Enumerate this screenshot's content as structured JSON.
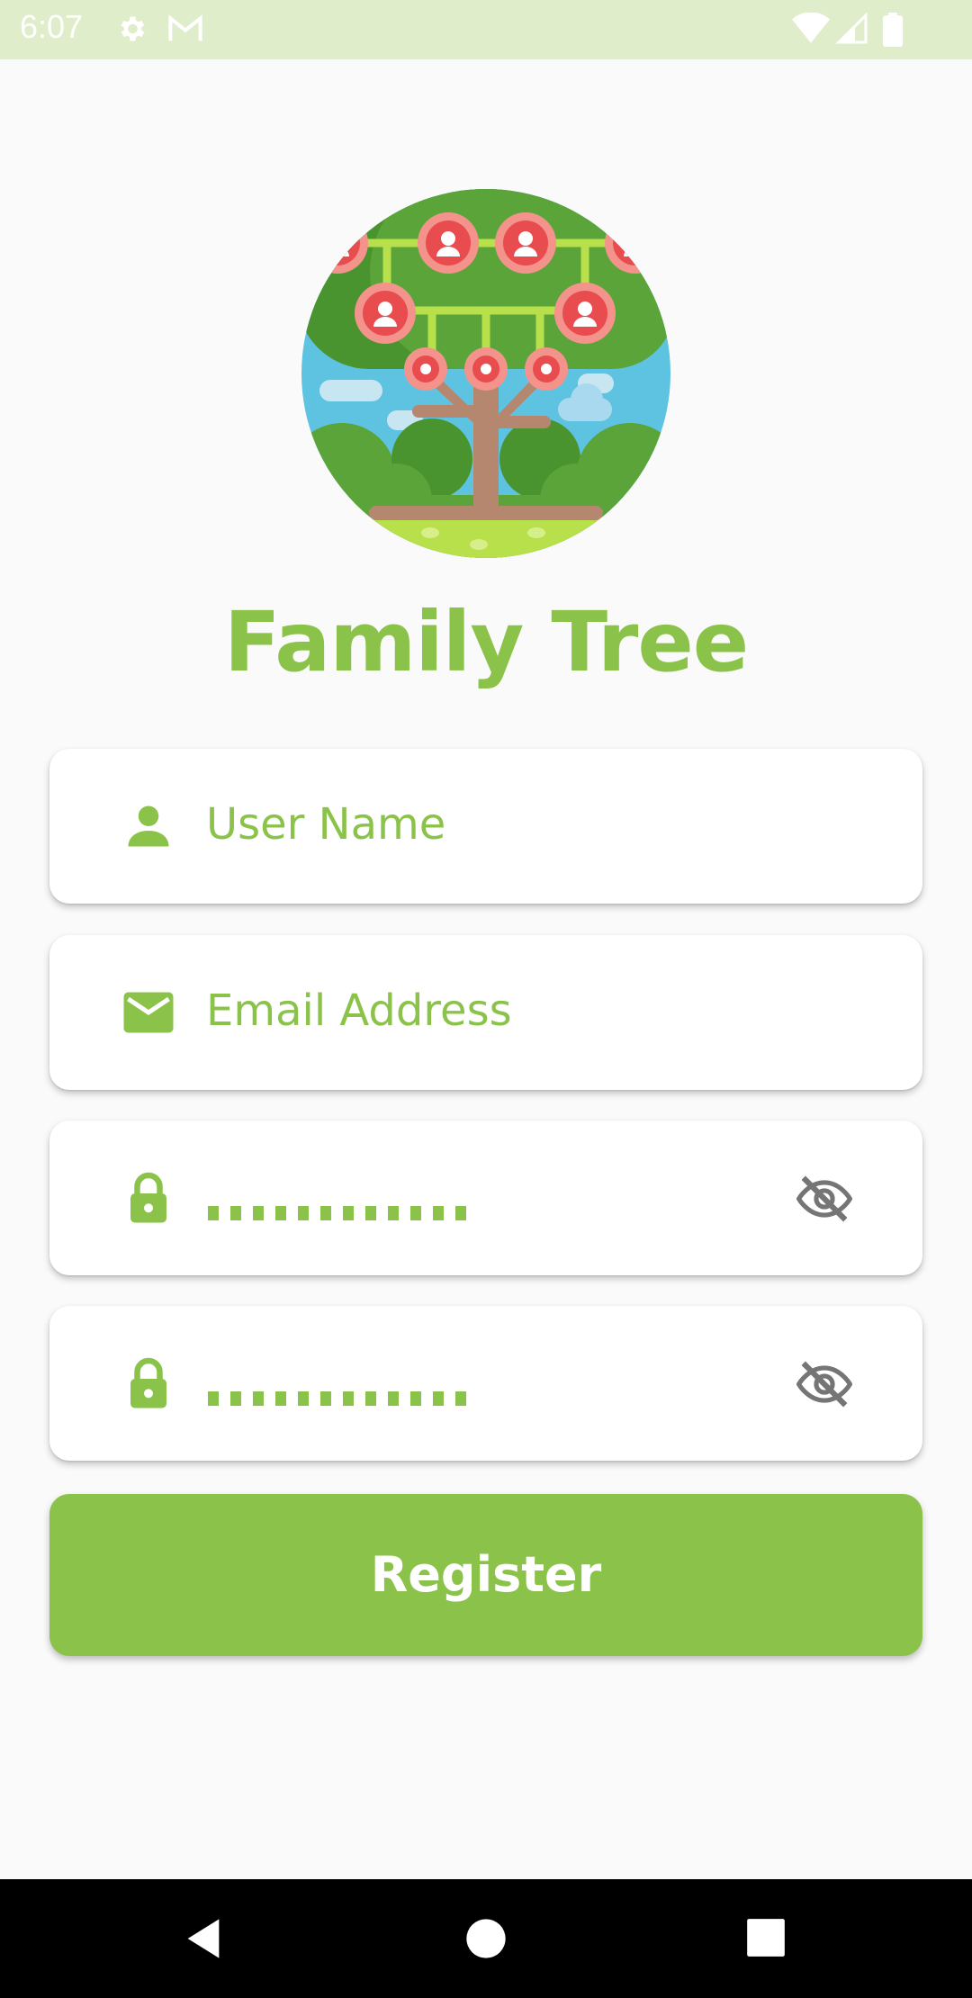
{
  "status_bar": {
    "time": "6:07",
    "icons": [
      "gear-icon",
      "gmail-icon",
      "wifi-icon",
      "signal-icon",
      "battery-icon"
    ]
  },
  "app": {
    "title": "Family Tree",
    "logo": "family-tree-logo"
  },
  "form": {
    "username": {
      "placeholder": "User Name",
      "icon": "person-icon"
    },
    "email": {
      "placeholder": "Email Address",
      "icon": "mail-icon"
    },
    "password": {
      "value_masked": "••••••••••••",
      "icon": "lock-icon",
      "toggle_icon": "eye-off-icon"
    },
    "confirm_password": {
      "value_masked": "••••••••••••",
      "icon": "lock-icon",
      "toggle_icon": "eye-off-icon"
    },
    "register_label": "Register"
  },
  "nav": {
    "buttons": [
      "back-icon",
      "home-icon",
      "recents-icon"
    ]
  },
  "colors": {
    "accent": "#8bc34a",
    "status_bar": "#dfedcb",
    "background": "#fafafa",
    "eye_icon": "#757575"
  }
}
